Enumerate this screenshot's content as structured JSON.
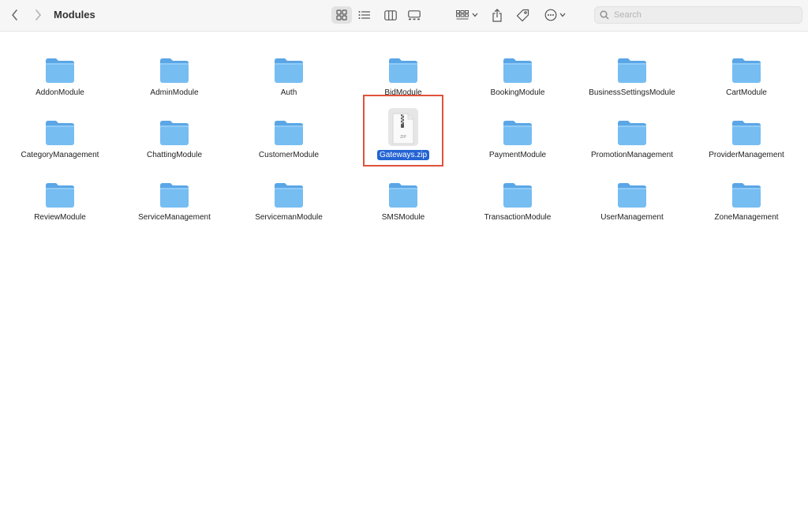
{
  "window": {
    "title": "Modules"
  },
  "toolbar": {
    "back_icon": "chevron-left-icon",
    "forward_icon": "chevron-right-icon",
    "view_modes": [
      "icon-view",
      "list-view",
      "column-view",
      "gallery-view"
    ],
    "active_view": "icon-view",
    "group_icon": "group-by-icon",
    "share_icon": "share-icon",
    "tag_icon": "tag-icon",
    "more_icon": "more-actions-icon"
  },
  "search": {
    "placeholder": "Search"
  },
  "items": [
    {
      "label": "AddonModule",
      "type": "folder"
    },
    {
      "label": "AdminModule",
      "type": "folder"
    },
    {
      "label": "Auth",
      "type": "folder"
    },
    {
      "label": "BidModule",
      "type": "folder"
    },
    {
      "label": "BookingModule",
      "type": "folder"
    },
    {
      "label": "BusinessSettingsModule",
      "type": "folder"
    },
    {
      "label": "CartModule",
      "type": "folder"
    },
    {
      "label": "CategoryManagement",
      "type": "folder"
    },
    {
      "label": "ChattingModule",
      "type": "folder"
    },
    {
      "label": "CustomerModule",
      "type": "folder"
    },
    {
      "label": "Gateways.zip",
      "type": "zip",
      "selected": true,
      "badge": "ZIP"
    },
    {
      "label": "PaymentModule",
      "type": "folder"
    },
    {
      "label": "PromotionManagement",
      "type": "folder"
    },
    {
      "label": "ProviderManagement",
      "type": "folder"
    },
    {
      "label": "ReviewModule",
      "type": "folder"
    },
    {
      "label": "ServiceManagement",
      "type": "folder"
    },
    {
      "label": "ServicemanModule",
      "type": "folder"
    },
    {
      "label": "SMSModule",
      "type": "folder"
    },
    {
      "label": "TransactionModule",
      "type": "folder"
    },
    {
      "label": "UserManagement",
      "type": "folder"
    },
    {
      "label": "ZoneManagement",
      "type": "folder"
    }
  ],
  "colors": {
    "folder": "#76bdf2",
    "folder_tab": "#5aa6e6",
    "selection": "#2463d4",
    "highlight_box": "#e0523a"
  }
}
